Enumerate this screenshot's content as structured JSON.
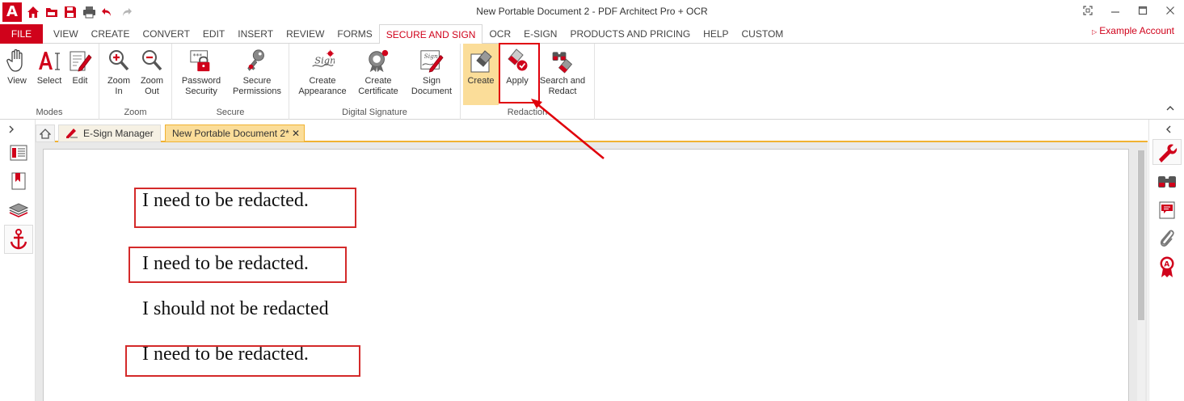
{
  "app": {
    "logo_text": "A",
    "window_title": "New Portable Document 2    -    PDF Architect Pro + OCR",
    "account_label": "Example Account"
  },
  "quick_access": [
    "home-icon",
    "open-folder-icon",
    "save-icon",
    "print-icon",
    "undo-icon",
    "redo-icon"
  ],
  "menu": {
    "file_label": "FILE",
    "tabs": [
      {
        "label": "VIEW"
      },
      {
        "label": "CREATE"
      },
      {
        "label": "CONVERT"
      },
      {
        "label": "EDIT"
      },
      {
        "label": "INSERT"
      },
      {
        "label": "REVIEW"
      },
      {
        "label": "FORMS"
      },
      {
        "label": "SECURE AND SIGN",
        "active": true
      },
      {
        "label": "OCR"
      },
      {
        "label": "E-SIGN"
      },
      {
        "label": "PRODUCTS AND PRICING"
      },
      {
        "label": "HELP"
      },
      {
        "label": "CUSTOM"
      }
    ]
  },
  "ribbon": {
    "groups": [
      {
        "label": "Modes",
        "buttons": [
          {
            "label": "View",
            "icon": "hand-icon"
          },
          {
            "label": "Select",
            "icon": "select-text-icon"
          },
          {
            "label": "Edit",
            "icon": "edit-icon"
          }
        ]
      },
      {
        "label": "Zoom",
        "buttons": [
          {
            "label": "Zoom In",
            "icon": "zoom-in-icon"
          },
          {
            "label": "Zoom Out",
            "icon": "zoom-out-icon"
          }
        ]
      },
      {
        "label": "Secure",
        "buttons": [
          {
            "label": "Password Security",
            "icon": "password-lock-icon"
          },
          {
            "label": "Secure Permissions",
            "icon": "key-icon"
          }
        ]
      },
      {
        "label": "Digital Signature",
        "buttons": [
          {
            "label": "Create Appearance",
            "icon": "signature-icon"
          },
          {
            "label": "Create Certificate",
            "icon": "certificate-icon"
          },
          {
            "label": "Sign Document",
            "icon": "sign-document-icon"
          }
        ]
      },
      {
        "label": "Redaction",
        "buttons": [
          {
            "label": "Create",
            "icon": "eraser-icon",
            "active": true
          },
          {
            "label": "Apply",
            "icon": "apply-redaction-icon"
          },
          {
            "label": "Search and Redact",
            "icon": "search-redact-icon"
          }
        ]
      }
    ]
  },
  "doc_tabs": [
    {
      "label": "E-Sign Manager"
    },
    {
      "label": "New Portable Document 2*",
      "active": true
    }
  ],
  "document": {
    "lines": [
      {
        "text": "I need to be redacted.",
        "marked": true
      },
      {
        "text": "I need to be redacted.",
        "marked": true
      },
      {
        "text": "I should not be redacted",
        "marked": false
      },
      {
        "text": "I need to be redacted.",
        "marked": true
      }
    ]
  },
  "colors": {
    "brand_red": "#d0021b",
    "active_tab_yellow": "#fbdd99",
    "tab_border_orange": "#f0b232",
    "annotation_red": "#e0000b"
  }
}
